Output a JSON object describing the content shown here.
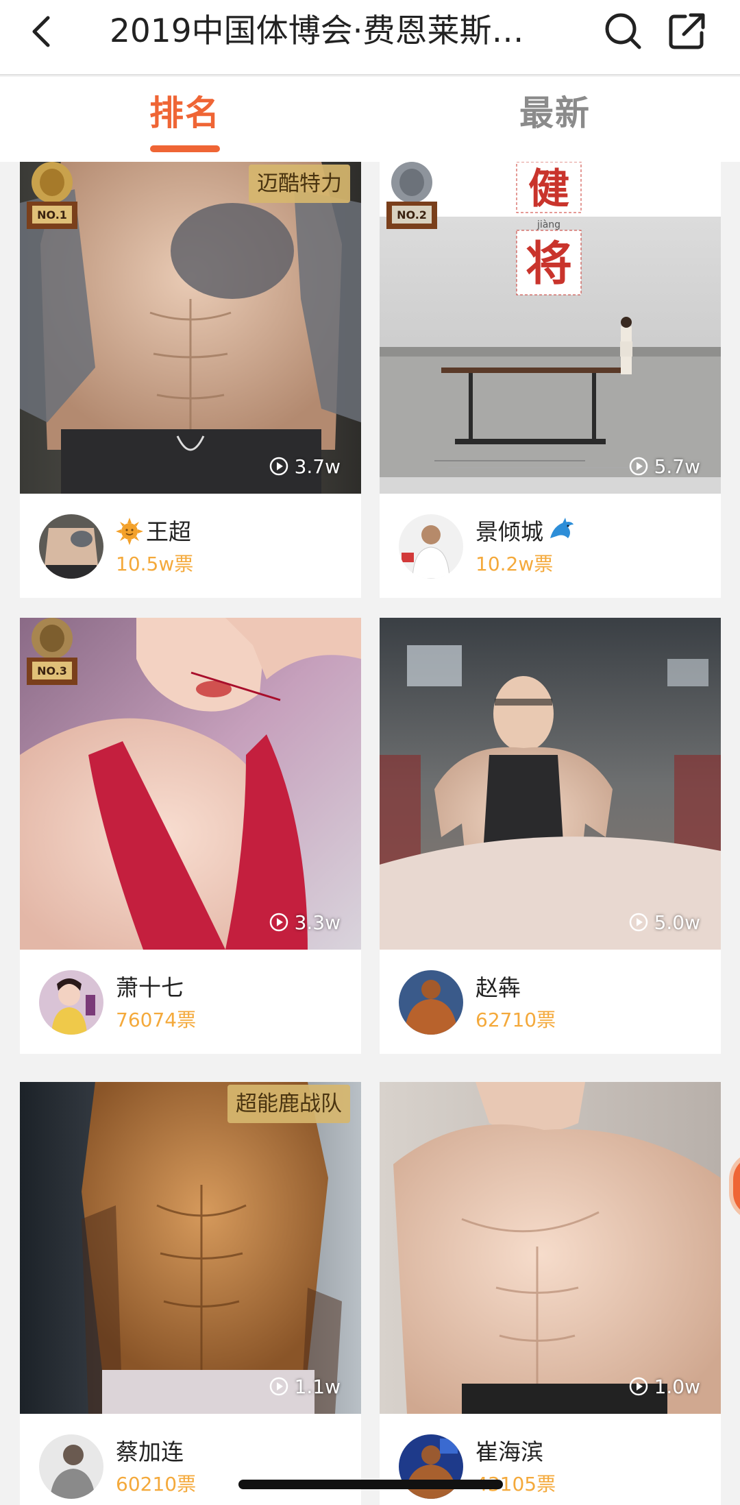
{
  "header": {
    "title": "2019中国体博会·费恩莱斯…",
    "back_icon": "chevron-left-icon",
    "search_icon": "search-icon",
    "share_icon": "share-icon"
  },
  "tabs": [
    {
      "label": "排名",
      "active": true
    },
    {
      "label": "最新",
      "active": false
    }
  ],
  "colors": {
    "accent": "#ef6535",
    "votes": "#f4a93b"
  },
  "cards": [
    {
      "name": "王超",
      "name_emoji": "sun-emoji",
      "votes": "10.5w票",
      "views": "3.7w",
      "team": "迈酷特力",
      "medal": "NO.1"
    },
    {
      "name": "景倾城",
      "name_emoji": "dolphin-emoji",
      "votes": "10.2w票",
      "views": "5.7w",
      "poster_text": [
        "健",
        "jiàng",
        "将"
      ],
      "medal": "NO.2"
    },
    {
      "name": "萧十七",
      "votes": "76074票",
      "views": "3.3w",
      "medal": "NO.3"
    },
    {
      "name": "赵犇",
      "votes": "62710票",
      "views": "5.0w"
    },
    {
      "name": "蔡加连",
      "votes": "60210票",
      "views": "1.1w",
      "team": "超能鹿战队"
    },
    {
      "name": "崔海滨",
      "votes": "43105票",
      "views": "1.0w"
    }
  ]
}
